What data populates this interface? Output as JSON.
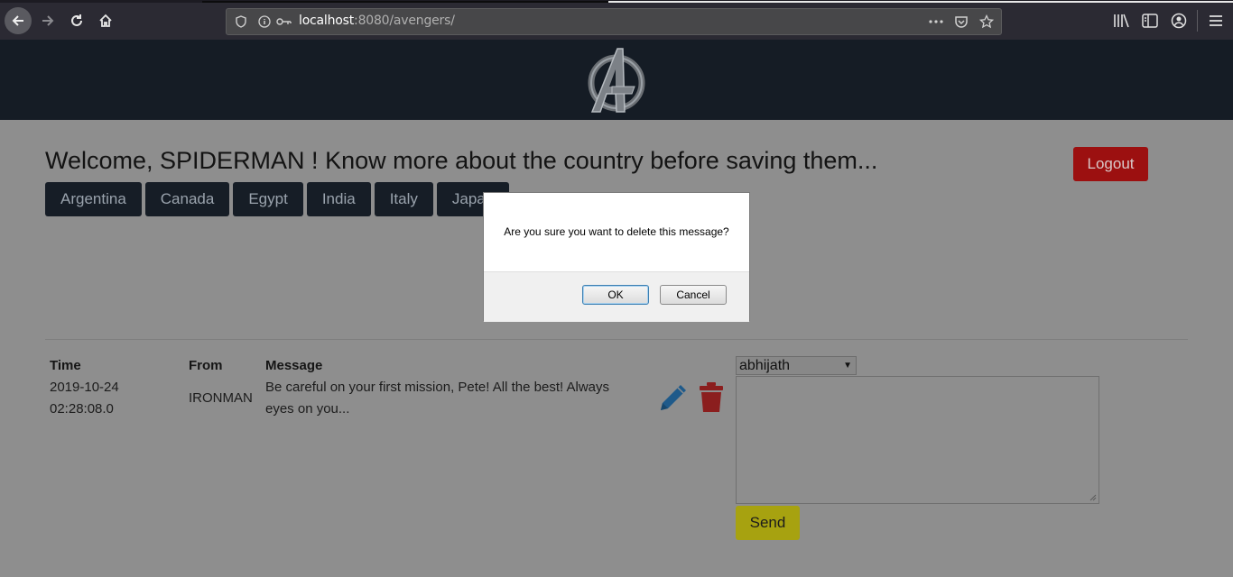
{
  "browser": {
    "url_host": "localhost",
    "url_rest": ":8080/avengers/"
  },
  "page": {
    "welcome": "Welcome, SPIDERMAN ! Know more about the country before saving them...",
    "logout_label": "Logout",
    "countries": [
      "Argentina",
      "Canada",
      "Egypt",
      "India",
      "Italy",
      "Japan"
    ]
  },
  "messages": {
    "headers": {
      "time": "Time",
      "from": "From",
      "message": "Message"
    },
    "rows": [
      {
        "time_date": "2019-10-24",
        "time_clock": "02:28:08.0",
        "from": "IRONMAN",
        "message_line1": "Be careful on your first mission, Pete! All the best! Always",
        "message_line2": "eyes on you..."
      }
    ]
  },
  "compose": {
    "recipient": "abhijath",
    "message_value": "",
    "send_label": "Send"
  },
  "dialog": {
    "message": "Are you sure you want to delete this message?",
    "ok_label": "OK",
    "cancel_label": "Cancel"
  },
  "colors": {
    "header_bg": "#151c25",
    "logout_bg": "#9c1010",
    "send_bg": "#a7a210",
    "edit_icon": "#1f5a8a",
    "delete_icon": "#8b1e1e"
  }
}
